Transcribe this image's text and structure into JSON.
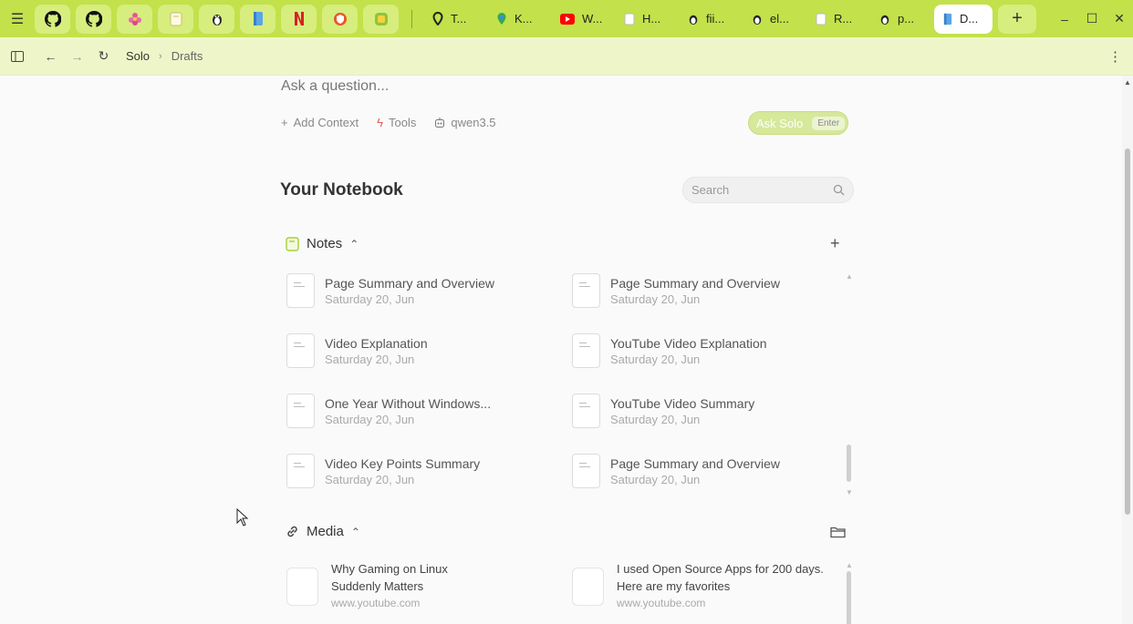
{
  "tabs": {
    "pinned": [
      {
        "icon": "github-icon"
      },
      {
        "icon": "github-icon"
      },
      {
        "icon": "flower-icon"
      },
      {
        "icon": "note-icon"
      },
      {
        "icon": "linux-icon"
      },
      {
        "icon": "book-icon"
      },
      {
        "icon": "netflix-icon"
      },
      {
        "icon": "shield-icon"
      },
      {
        "icon": "app-icon"
      }
    ],
    "open": [
      {
        "label": "T...",
        "icon": "pin-icon"
      },
      {
        "label": "K...",
        "icon": "maps-icon"
      },
      {
        "label": "W...",
        "icon": "youtube-icon"
      },
      {
        "label": "H...",
        "icon": "note-icon"
      },
      {
        "label": "fii...",
        "icon": "linux-icon"
      },
      {
        "label": "el...",
        "icon": "linux-icon"
      },
      {
        "label": "R...",
        "icon": "note-icon"
      },
      {
        "label": "p...",
        "icon": "linux-icon"
      },
      {
        "label": "D...",
        "icon": "book-icon",
        "active": true
      }
    ]
  },
  "breadcrumb": {
    "root": "Solo",
    "current": "Drafts"
  },
  "ask": {
    "placeholder": "Ask a question...",
    "add_context": "Add Context",
    "tools": "Tools",
    "model": "qwen3.5",
    "button": "Ask Solo",
    "shortcut": "Enter"
  },
  "notebook": {
    "title": "Your Notebook",
    "search_placeholder": "Search"
  },
  "notes": {
    "title": "Notes",
    "items": [
      {
        "title": "Page Summary and Overview",
        "date": "Saturday 20, Jun"
      },
      {
        "title": "Page Summary and Overview",
        "date": "Saturday 20, Jun"
      },
      {
        "title": "Video Explanation",
        "date": "Saturday 20, Jun"
      },
      {
        "title": "YouTube Video Explanation",
        "date": "Saturday 20, Jun"
      },
      {
        "title": "One Year Without Windows...",
        "date": "Saturday 20, Jun"
      },
      {
        "title": "YouTube Video Summary",
        "date": "Saturday 20, Jun"
      },
      {
        "title": "Video Key Points Summary",
        "date": "Saturday 20, Jun"
      },
      {
        "title": "Page Summary and Overview",
        "date": "Saturday 20, Jun"
      }
    ]
  },
  "media": {
    "title": "Media",
    "items": [
      {
        "title_line1": "Why Gaming on Linux",
        "title_line2": "Suddenly Matters",
        "host": "www.youtube.com"
      },
      {
        "title_line1": "I used Open Source Apps for 200 days.",
        "title_line2": "Here are my favorites",
        "host": "www.youtube.com"
      }
    ]
  },
  "colors": {
    "tabbar": "#c3e14a",
    "navbar": "#eef6c9",
    "accent_button": "#d6e89a"
  }
}
